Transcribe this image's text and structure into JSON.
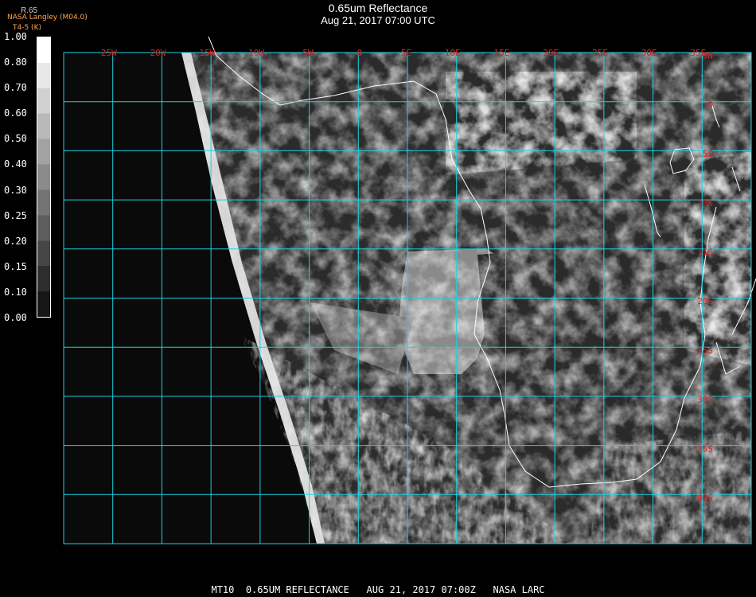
{
  "header": {
    "title": "0.65um Reflectance",
    "datetime": "Aug 21, 2017 07:00 UTC"
  },
  "credit": {
    "line1": "NASA Langley (M04.0)",
    "line2": "T4-5 (K)",
    "scale_fragment": "R.65"
  },
  "colorbar": {
    "labels": [
      "1.00",
      "0.80",
      "0.70",
      "0.60",
      "0.50",
      "0.40",
      "0.30",
      "0.25",
      "0.20",
      "0.15",
      "0.10",
      "0.00"
    ]
  },
  "map": {
    "lon_labels": [
      "25W",
      "20W",
      "15W",
      "10W",
      "5W",
      "0",
      "5E",
      "10E",
      "15E",
      "20E",
      "25E",
      "30E",
      "35E"
    ],
    "lat_labels": [
      "5N",
      "0",
      "5S",
      "10S",
      "15S",
      "20S",
      "25S",
      "30S",
      "35S",
      "40S"
    ],
    "grid_color": "#19d3e3",
    "label_color": "#e02020",
    "coast_color": "#ffffff"
  },
  "footer": {
    "text": "MT10  0.65UM REFLECTANCE   AUG 21, 2017 07:00Z   NASA LARC"
  }
}
